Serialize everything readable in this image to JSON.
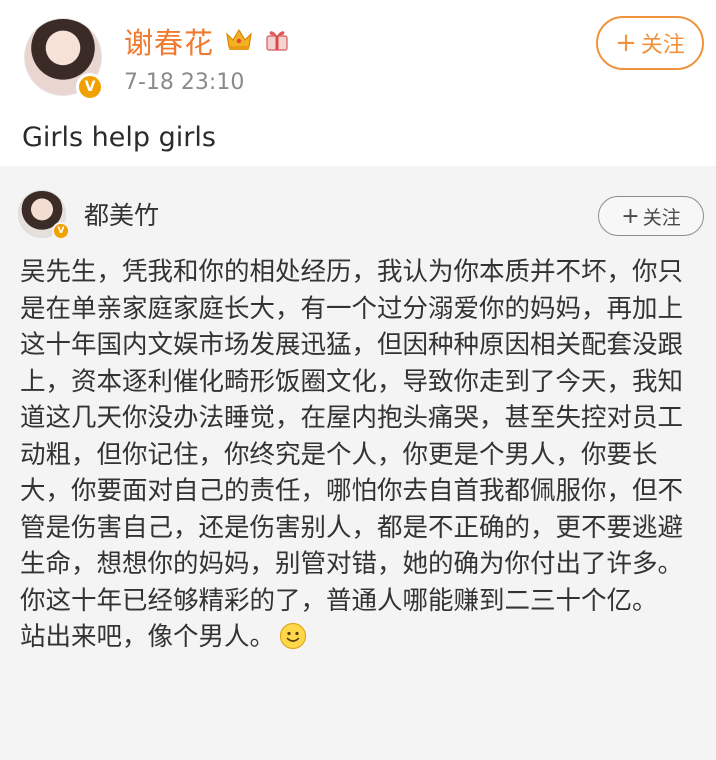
{
  "post": {
    "author": "谢春花",
    "timestamp": "7-18 23:10",
    "follow_label": "关注",
    "text": "Girls help girls",
    "badges": [
      "crown-icon",
      "gift-icon"
    ],
    "verified": true
  },
  "repost": {
    "author": "都美竹",
    "follow_label": "关注",
    "verified": true,
    "paragraphs": [
      "吴先生，凭我和你的相处经历，我认为你本质并不坏，你只是在单亲家庭家庭长大，有一个过分溺爱你的妈妈，再加上这十年国内文娱市场发展迅猛，但因种种原因相关配套没跟上，资本逐利催化畸形饭圈文化，导致你走到了今天，我知道这几天你没办法睡觉，在屋内抱头痛哭，甚至失控对员工动粗，但你记住，你终究是个人，你更是个男人，你要长大，你要面对自己的责任，哪怕你去自首我都佩服你，但不管是伤害自己，还是伤害别人，都是不正确的，更不要逃避生命，想想你的妈妈，别管对错，她的确为你付出了许多。",
      "你这十年已经够精彩的了，普通人哪能赚到二三十个亿。",
      "站出来吧，像个男人。"
    ],
    "emoji": "smile-icon"
  },
  "colors": {
    "author_name": "#f07a2f",
    "follow_accent": "#f0933c",
    "verified_badge": "#f0a000",
    "repost_background": "#f4f4f4"
  }
}
